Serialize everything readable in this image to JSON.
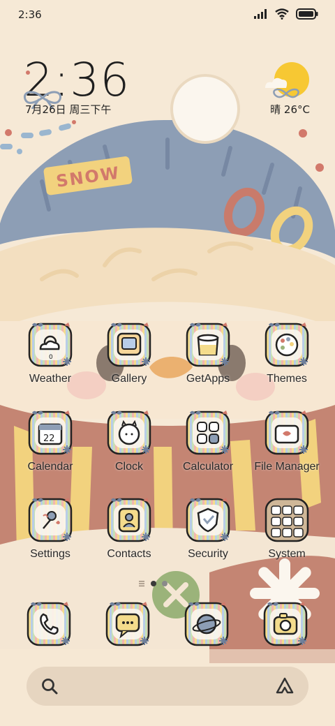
{
  "status_bar": {
    "time": "2:36",
    "icons": [
      "signal-icon",
      "wifi-icon",
      "battery-icon"
    ]
  },
  "clock_widget": {
    "time": "2:36",
    "date": "7月26日 周三下午"
  },
  "weather_widget": {
    "condition_icon": "sun-cloud-icon",
    "text": "晴 26°C"
  },
  "wallpaper": {
    "hat_text": "SNOW",
    "colors": {
      "background": "#f6e9d6",
      "hat_blue": "#8d9eb5",
      "scarf_red": "#c48573",
      "scarf_yellow": "#f2d27e",
      "accent_red": "#d2796b"
    }
  },
  "apps": [
    {
      "label": "Weather",
      "icon": "weather-icon"
    },
    {
      "label": "Gallery",
      "icon": "gallery-icon"
    },
    {
      "label": "GetApps",
      "icon": "getapps-icon"
    },
    {
      "label": "Themes",
      "icon": "themes-icon"
    },
    {
      "label": "Calendar",
      "icon": "calendar-icon",
      "icon_text": "22"
    },
    {
      "label": "Clock",
      "icon": "clock-icon"
    },
    {
      "label": "Calculator",
      "icon": "calculator-icon"
    },
    {
      "label": "File Manager",
      "icon": "file-manager-icon"
    },
    {
      "label": "Settings",
      "icon": "settings-icon"
    },
    {
      "label": "Contacts",
      "icon": "contacts-icon"
    },
    {
      "label": "Security",
      "icon": "security-icon"
    },
    {
      "label": "System",
      "icon": "system-folder-icon"
    }
  ],
  "dock": [
    {
      "icon": "phone-icon"
    },
    {
      "icon": "messages-icon"
    },
    {
      "icon": "browser-icon"
    },
    {
      "icon": "camera-icon"
    }
  ],
  "page_indicator": {
    "pages": 2,
    "current": 1
  },
  "search_bar": {
    "left_icon": "search-icon",
    "right_icon": "assistant-icon"
  }
}
